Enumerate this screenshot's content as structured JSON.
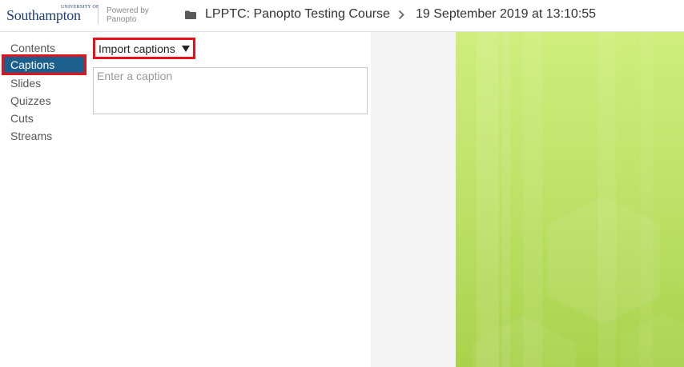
{
  "header": {
    "logo_small": "UNIVERSITY OF",
    "logo_big": "Southampton",
    "powered_line1": "Powered by",
    "powered_line2": "Panopto",
    "course_title": "LPPTC: Panopto Testing Course",
    "session_date": "19 September 2019 at 13:10:55"
  },
  "nav": {
    "items": [
      {
        "label": "Contents"
      },
      {
        "label": "Captions"
      },
      {
        "label": "Slides"
      },
      {
        "label": "Quizzes"
      },
      {
        "label": "Cuts"
      },
      {
        "label": "Streams"
      }
    ],
    "active": "Captions"
  },
  "captions": {
    "import_label": "Import captions",
    "input_placeholder": "Enter a caption",
    "input_value": ""
  },
  "icons": {
    "folder": "folder-icon",
    "chevron": "chevron-right-icon",
    "dropdown": "triangle-down-icon"
  },
  "colors": {
    "accent_active": "#1b5f8c",
    "highlight_border": "#e4121b",
    "brand": "#1f3f77",
    "video_green": "#b6de58"
  }
}
